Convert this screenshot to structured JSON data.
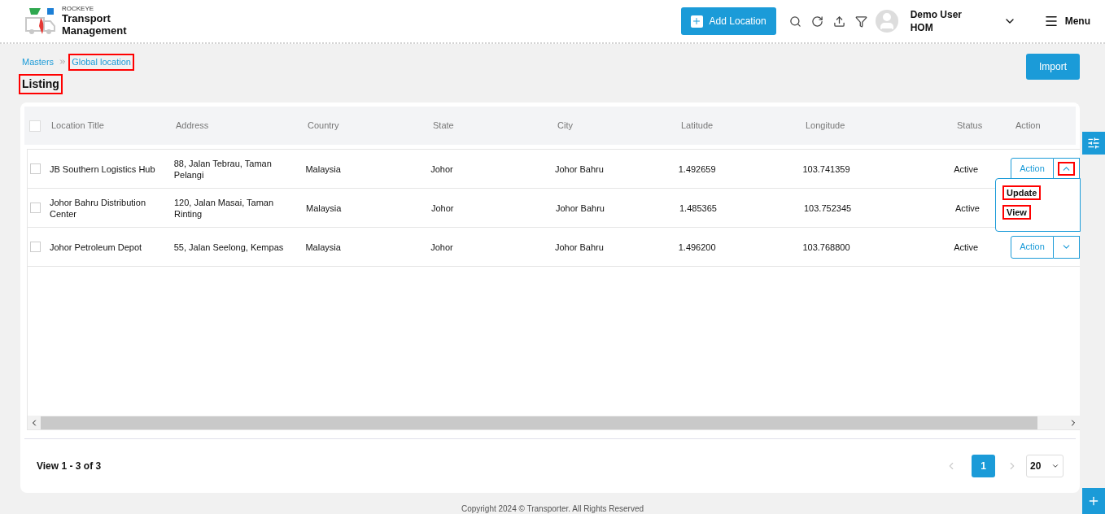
{
  "header": {
    "brand_small": "ROCKEYE",
    "brand_line1": "Transport",
    "brand_line2": "Management",
    "add_button": "Add Location",
    "user_name": "Demo User",
    "user_role": "HOM",
    "menu_label": "Menu"
  },
  "breadcrumb": [
    {
      "label": "Masters",
      "highlighted": false
    },
    {
      "label": "Global location",
      "highlighted": true
    }
  ],
  "page_title": {
    "text": "Listing",
    "highlighted": true
  },
  "import_button": "Import",
  "table": {
    "select_all_checked": false,
    "columns": [
      "Location Title",
      "Address",
      "Country",
      "State",
      "City",
      "Latitude",
      "Longitude",
      "Status",
      "Action"
    ],
    "rows": [
      {
        "checked": false,
        "cells": [
          "JB Southern Logistics Hub",
          "88, Jalan Tebrau, Taman Pelangi",
          "Malaysia",
          "Johor",
          "Johor Bahru",
          "1.492659",
          "103.741359",
          "Active"
        ],
        "action": "Action",
        "expanded": true,
        "caret_highlighted": true,
        "menu": [
          {
            "label": "Update",
            "highlighted": true
          },
          {
            "label": "View",
            "highlighted": true
          }
        ]
      },
      {
        "checked": false,
        "cells": [
          "Johor Bahru Distribution Center",
          "120, Jalan Masai, Taman Rinting",
          "Malaysia",
          "Johor",
          "Johor Bahru",
          "1.485365",
          "103.752345",
          "Active"
        ]
      },
      {
        "checked": false,
        "cells": [
          "Johor Petroleum Depot",
          "55, Jalan Seelong, Kempas",
          "Malaysia",
          "Johor",
          "Johor Bahru",
          "1.496200",
          "103.768800",
          "Active"
        ],
        "action": "Action",
        "expanded": false,
        "caret_highlighted": false
      }
    ]
  },
  "footer": {
    "summary": "View 1 - 3 of 3",
    "pages": [
      {
        "label": "1",
        "selected": true
      }
    ],
    "page_size": "20"
  },
  "copyright": "Copyright 2024 © Transporter. All Rights Reserved"
}
